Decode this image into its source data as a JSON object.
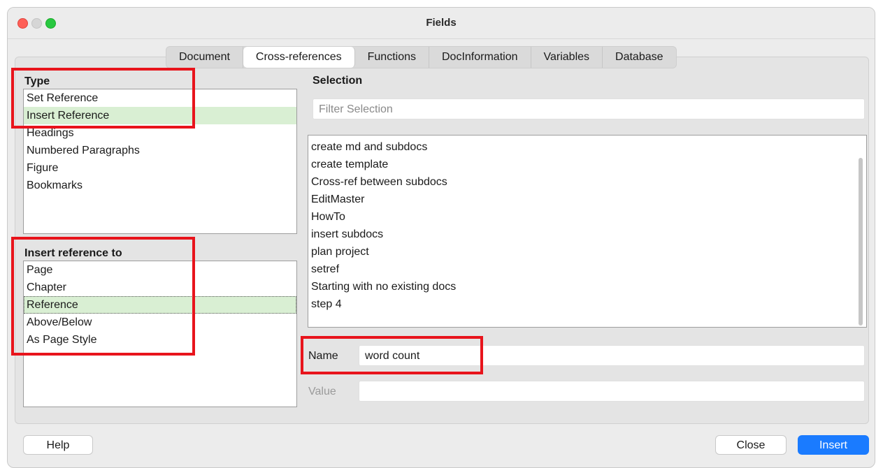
{
  "window": {
    "title": "Fields"
  },
  "tabs": [
    {
      "label": "Document"
    },
    {
      "label": "Cross-references"
    },
    {
      "label": "Functions"
    },
    {
      "label": "DocInformation"
    },
    {
      "label": "Variables"
    },
    {
      "label": "Database"
    }
  ],
  "active_tab": "Cross-references",
  "type": {
    "label": "Type",
    "items": [
      "Set Reference",
      "Insert Reference",
      "Headings",
      "Numbered Paragraphs",
      "Figure",
      "Bookmarks"
    ],
    "selected": "Insert Reference"
  },
  "insert_ref": {
    "label": "Insert reference to",
    "items": [
      "Page",
      "Chapter",
      "Reference",
      "Above/Below",
      "As Page Style"
    ],
    "selected": "Reference"
  },
  "selection": {
    "label": "Selection",
    "filter_placeholder": "Filter Selection",
    "items": [
      "create md and subdocs",
      "create template",
      "Cross-ref between subdocs",
      "EditMaster",
      "HowTo",
      "insert subdocs",
      "plan project",
      "setref",
      "Starting with no existing docs",
      "step 4"
    ]
  },
  "name_field": {
    "label": "Name",
    "value": "word count"
  },
  "value_field": {
    "label": "Value",
    "value": ""
  },
  "buttons": {
    "help": "Help",
    "close": "Close",
    "insert": "Insert"
  },
  "colors": {
    "annotation": "#e8141c",
    "selection_highlight": "#d9efd3",
    "primary": "#1a7bff"
  }
}
